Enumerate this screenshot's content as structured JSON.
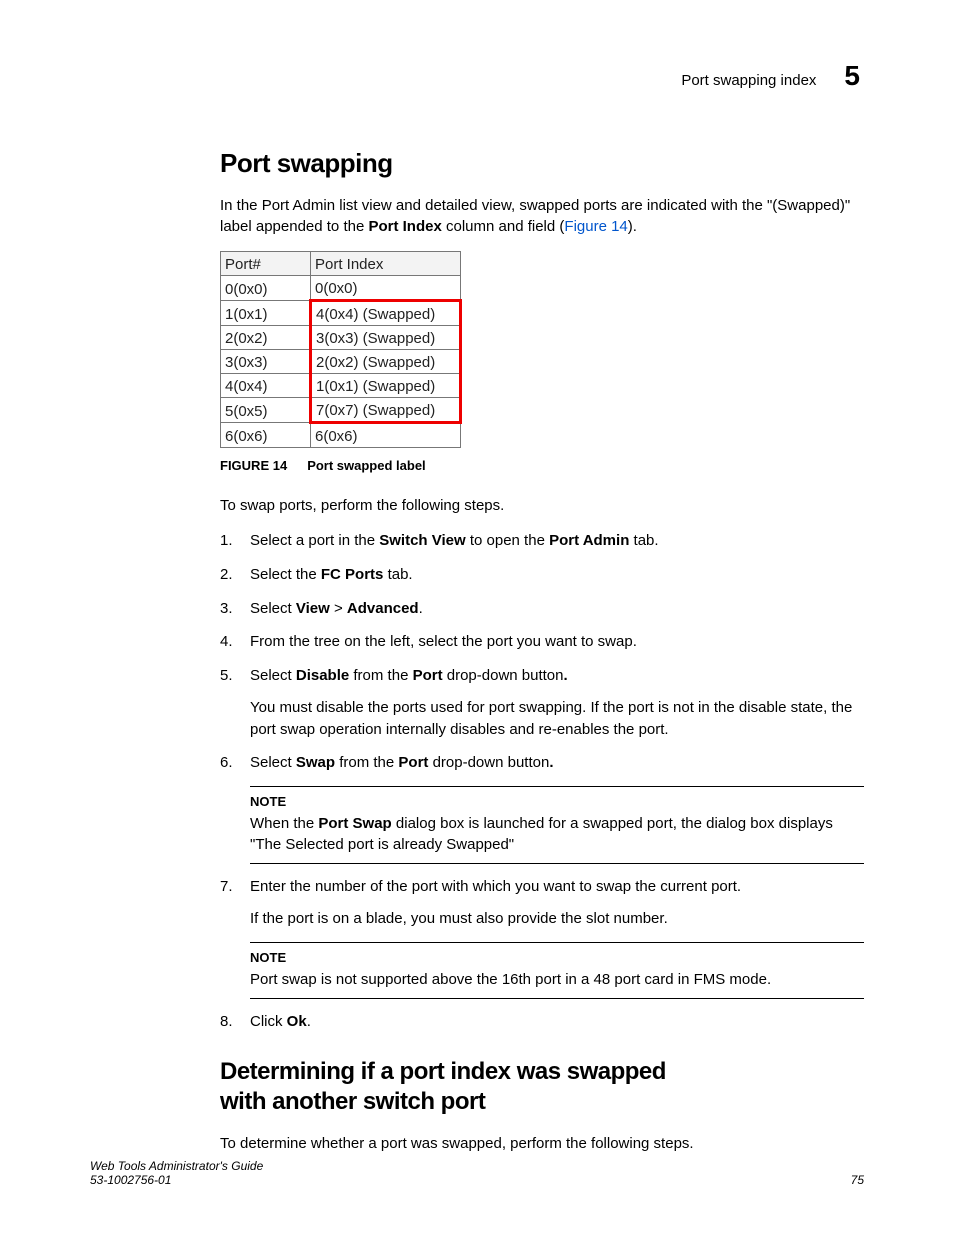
{
  "header": {
    "text": "Port swapping index",
    "chapter": "5"
  },
  "section1": {
    "title": "Port swapping",
    "intro_a": "In the Port Admin list view and detailed view, swapped ports are indicated with the \"(Swapped)\" label appended to the ",
    "intro_bold": "Port Index",
    "intro_b": " column and field (",
    "intro_link": "Figure 14",
    "intro_c": ")."
  },
  "table": {
    "headers": {
      "port": "Port#",
      "index": "Port Index"
    },
    "rows": [
      {
        "port": "0(0x0)",
        "index": "0(0x0)",
        "swapped": false
      },
      {
        "port": "1(0x1)",
        "index": "4(0x4) (Swapped)",
        "swapped": true
      },
      {
        "port": "2(0x2)",
        "index": "3(0x3) (Swapped)",
        "swapped": true
      },
      {
        "port": "3(0x3)",
        "index": "2(0x2) (Swapped)",
        "swapped": true
      },
      {
        "port": "4(0x4)",
        "index": "1(0x1) (Swapped)",
        "swapped": true
      },
      {
        "port": "5(0x5)",
        "index": "7(0x7) (Swapped)",
        "swapped": true
      },
      {
        "port": "6(0x6)",
        "index": "6(0x6)",
        "swapped": false
      }
    ]
  },
  "figcap": {
    "label": "FIGURE 14",
    "text": "Port swapped label"
  },
  "steps_intro": "To swap ports, perform the following steps.",
  "steps": {
    "s1_a": "Select a port in the ",
    "s1_b1": "Switch View",
    "s1_c": " to open the ",
    "s1_b2": "Port Admin",
    "s1_d": " tab.",
    "s2_a": "Select the ",
    "s2_b": "FC Ports",
    "s2_c": " tab.",
    "s3_a": "Select ",
    "s3_b1": "View",
    "s3_mid": " > ",
    "s3_b2": "Advanced",
    "s3_c": ".",
    "s4": "From the tree on the left, select the port you want to swap.",
    "s5_a": "Select ",
    "s5_b1": "Disable",
    "s5_mid": " from the ",
    "s5_b2": "Port",
    "s5_c": " drop-down button",
    "s5_sub": "You must disable the ports used for port swapping. If the port is not in the disable state, the port swap operation internally disables and re-enables the port.",
    "s6_a": "Select ",
    "s6_b1": "Swap",
    "s6_mid": " from the ",
    "s6_b2": "Port",
    "s6_c": " drop-down button",
    "note1_label": "NOTE",
    "note1_a": "When the ",
    "note1_b": "Port Swap",
    "note1_c": " dialog box is launched for a swapped port, the dialog box displays \"The Selected port is already Swapped\"",
    "s7": "Enter the number of the port with which you want to swap the current port.",
    "s7_sub": "If the port is on a blade, you must also provide the slot number.",
    "note2_label": "NOTE",
    "note2": "Port swap is not supported above the 16th port in a 48 port card in FMS mode.",
    "s8_a": "Click ",
    "s8_b": "Ok",
    "s8_c": "."
  },
  "section2": {
    "title_l1": "Determining if a port index was swapped",
    "title_l2": "with another switch port",
    "intro": "To determine whether a port was swapped, perform the following steps."
  },
  "footer": {
    "l1": "Web Tools Administrator's Guide",
    "l2": "53-1002756-01",
    "page": "75"
  }
}
